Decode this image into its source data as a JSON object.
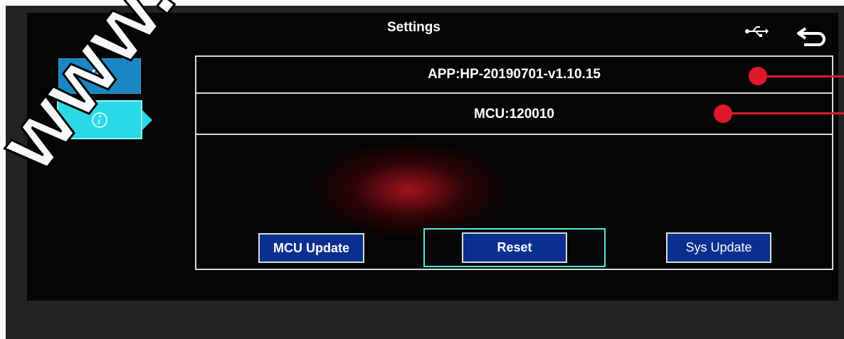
{
  "header": {
    "title": "Settings",
    "usb_icon": "usb-icon",
    "back_icon": "back-arrow-icon"
  },
  "sidebar": {
    "items": [
      {
        "name": "settings",
        "icon": "gear-icon",
        "selected": false
      },
      {
        "name": "info",
        "icon": "info-icon",
        "selected": true
      }
    ]
  },
  "info_panel": {
    "app_version": "APP:HP-20190701-v1.10.15",
    "mcu_version": "MCU:120010"
  },
  "buttons": {
    "mcu_update": "MCU Update",
    "reset": "Reset",
    "sys_update": "Sys Update"
  },
  "watermark": "www.ico",
  "colors": {
    "accent": "#2ad8e6",
    "button_blue": "#0b2f8f",
    "marker_red": "#e0182e"
  }
}
